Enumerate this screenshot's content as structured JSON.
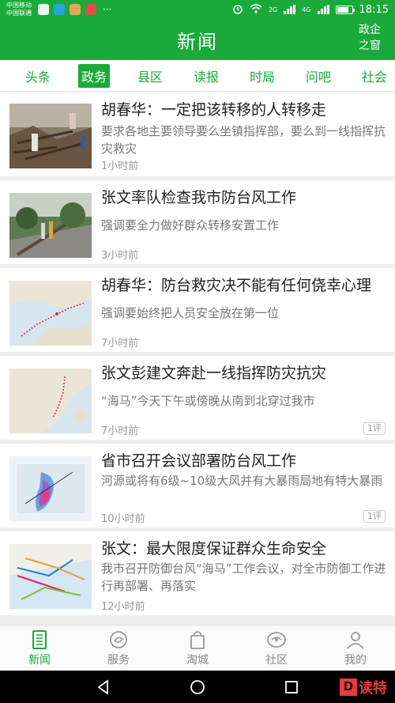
{
  "status_bar": {
    "carrier_1": "中国移动",
    "carrier_2": "中国联通",
    "network_1": "2G",
    "network_2": "4G",
    "dots": "···",
    "time": "18:15"
  },
  "header": {
    "title": "新闻",
    "right_line1": "政企",
    "right_line2": "之窗"
  },
  "tabs": [
    {
      "label": "头条",
      "active": false
    },
    {
      "label": "政务",
      "active": true
    },
    {
      "label": "县区",
      "active": false
    },
    {
      "label": "读报",
      "active": false
    },
    {
      "label": "时局",
      "active": false
    },
    {
      "label": "问吧",
      "active": false
    },
    {
      "label": "社会",
      "active": false
    }
  ],
  "news": [
    {
      "title": "胡春华：一定把该转移的人转移走",
      "summary": "要求各地主要领导要么坐镇指挥部，要么到一线指挥抗灾救灾",
      "time": "1小时前",
      "comments": ""
    },
    {
      "title": "张文率队检查我市防台风工作",
      "summary": "强调要全力做好群众转移安置工作",
      "time": "3小时前",
      "comments": ""
    },
    {
      "title": "胡春华：防台救灾决不能有任何侥幸心理",
      "summary": "强调要始终把人员安全放在第一位",
      "time": "7小时前",
      "comments": ""
    },
    {
      "title": "张文彭建文奔赴一线指挥防灾抗灾",
      "summary": "“海马”今天下午或傍晚从南到北穿过我市",
      "time": "7小时前",
      "comments": "1评"
    },
    {
      "title": "省市召开会议部署防台风工作",
      "summary": "河源或将有6级~10级大风并有大暴雨局地有特大暴雨",
      "time": "10小时前",
      "comments": "1评"
    },
    {
      "title": "张文：最大限度保证群众生命安全",
      "summary": "我市召开防御台风“海马”工作会议，对全市防御工作进行再部署、再落实",
      "time": "12小时前",
      "comments": ""
    }
  ],
  "bottom_nav": [
    {
      "label": "新闻",
      "icon": "news-icon",
      "active": true
    },
    {
      "label": "服务",
      "icon": "service-icon",
      "active": false
    },
    {
      "label": "淘城",
      "icon": "shopping-bag-icon",
      "active": false
    },
    {
      "label": "社区",
      "icon": "community-icon",
      "active": false
    },
    {
      "label": "我的",
      "icon": "profile-icon",
      "active": false
    }
  ],
  "watermark": {
    "mark": "D",
    "text": "读特"
  },
  "colors": {
    "accent": "#1aaa3a",
    "background": "#eeeeee",
    "text_secondary": "#777777"
  }
}
